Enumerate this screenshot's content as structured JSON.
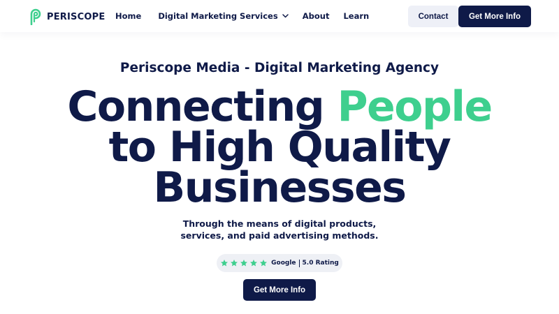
{
  "brand": {
    "name": "PERISCOPE",
    "logo_icon": "periscope-p-logo-icon",
    "accent_color": "#3ecf8e",
    "primary_color": "#0f1a48"
  },
  "nav": {
    "items": [
      {
        "label": "Home"
      },
      {
        "label": "Digital Marketing Services",
        "icon": "chevron-down-icon"
      },
      {
        "label": "About"
      },
      {
        "label": "Learn"
      }
    ],
    "contact_label": "Contact",
    "cta_label": "Get More Info"
  },
  "hero": {
    "subtitle": "Periscope Media - Digital Marketing Agency",
    "headline_part1": "Connecting ",
    "headline_accent": "People",
    "headline_line2": "to High Quality",
    "headline_line3": "Businesses",
    "lead_line1": "Through the means of digital products,",
    "lead_line2": "services, and paid advertising methods.",
    "rating": {
      "stars": 5,
      "star_icon": "star-icon",
      "source": "Google",
      "score": "5.0 Rating"
    },
    "cta_label": "Get More Info"
  }
}
